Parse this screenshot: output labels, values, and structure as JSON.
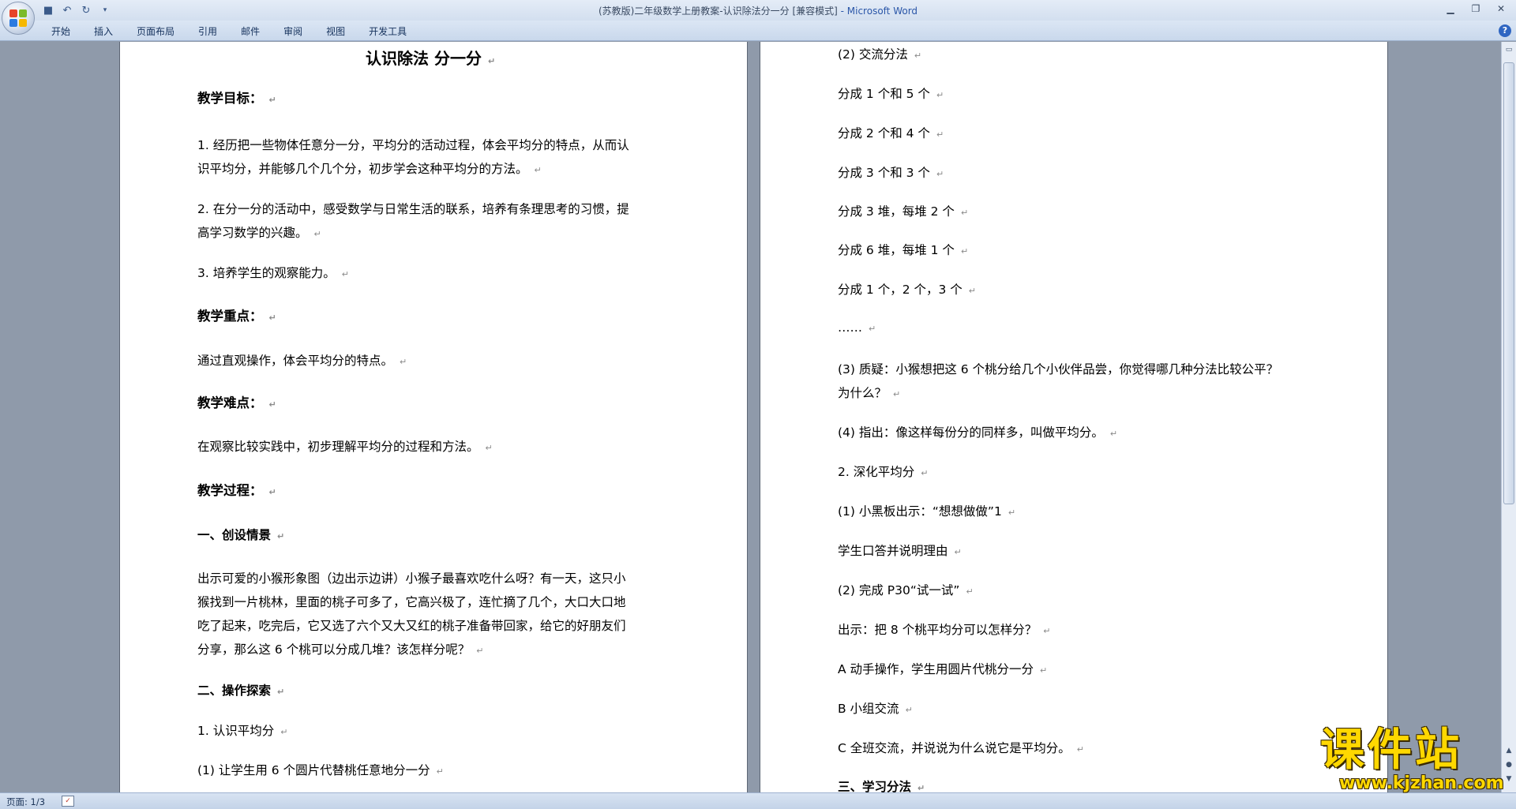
{
  "window": {
    "title": "(苏教版)二年级数学上册教案-认识除法分一分 [兼容模式]",
    "app_name": " - Microsoft Word"
  },
  "ribbon": {
    "tabs": [
      "开始",
      "插入",
      "页面布局",
      "引用",
      "邮件",
      "审阅",
      "视图",
      "开发工具"
    ]
  },
  "page1": {
    "title": "认识除法  分一分",
    "goal_heading": "教学目标：",
    "goal_1a": "1. 经历把一些物体任意分一分，平均分的活动过程，体会平均分的特点，从而认",
    "goal_1b": "识平均分，并能够几个几个分，初步学会这种平均分的方法。",
    "goal_2a": "2. 在分一分的活动中，感受数学与日常生活的联系，培养有条理思考的习惯，提",
    "goal_2b": "高学习数学的兴趣。",
    "goal_3": "3. 培养学生的观察能力。",
    "key_heading": "教学重点：",
    "key_text": "通过直观操作，体会平均分的特点。",
    "diff_heading": "教学难点：",
    "diff_text": "在观察比较实践中，初步理解平均分的过程和方法。",
    "process_heading": "教学过程：",
    "sec1_heading": "一、创设情景",
    "sec1_a": "出示可爱的小猴形象图（边出示边讲）小猴子最喜欢吃什么呀？有一天，这只小",
    "sec1_b": "猴找到一片桃林，里面的桃子可多了，它高兴极了，连忙摘了几个，大口大口地",
    "sec1_c": "吃了起来，吃完后，它又选了六个又大又红的桃子准备带回家，给它的好朋友们",
    "sec1_d": "分享，那么这 6 个桃可以分成几堆？该怎样分呢？",
    "sec2_heading": "二、操作探索",
    "sec2_1": "1. 认识平均分",
    "sec2_1_1": "(1) 让学生用 6 个圆片代替桃任意地分一分"
  },
  "page2": {
    "l01": "(2) 交流分法",
    "l02": "分成 1 个和 5 个",
    "l03": "分成 2 个和 4 个",
    "l04": "分成 3 个和 3 个",
    "l05": "分成 3 堆，每堆 2 个",
    "l06": "分成 6 堆，每堆 1 个",
    "l07": "分成 1 个，2 个，3 个",
    "l08": "……",
    "l09a": "(3) 质疑：小猴想把这 6 个桃分给几个小伙伴品尝，你觉得哪几种分法比较公平？",
    "l09b": "为什么？",
    "l10": "(4) 指出：像这样每份分的同样多，叫做平均分。",
    "l11": "2. 深化平均分",
    "l12": "(1) 小黑板出示：“想想做做”1",
    "l13": "学生口答并说明理由",
    "l14": "(2) 完成 P30“试一试”",
    "l15": "出示：把 8 个桃平均分可以怎样分？",
    "l16": "A 动手操作，学生用圆片代桃分一分",
    "l17": "B 小组交流",
    "l18": "C 全班交流，并说说为什么说它是平均分。",
    "l19": "三、学习分法"
  },
  "statusbar": {
    "page_indicator": "页面: 1/3"
  },
  "watermark": {
    "text": "课件站",
    "url": "www.kjzhan.com"
  },
  "icons": {
    "paragraph_mark": "↵"
  }
}
